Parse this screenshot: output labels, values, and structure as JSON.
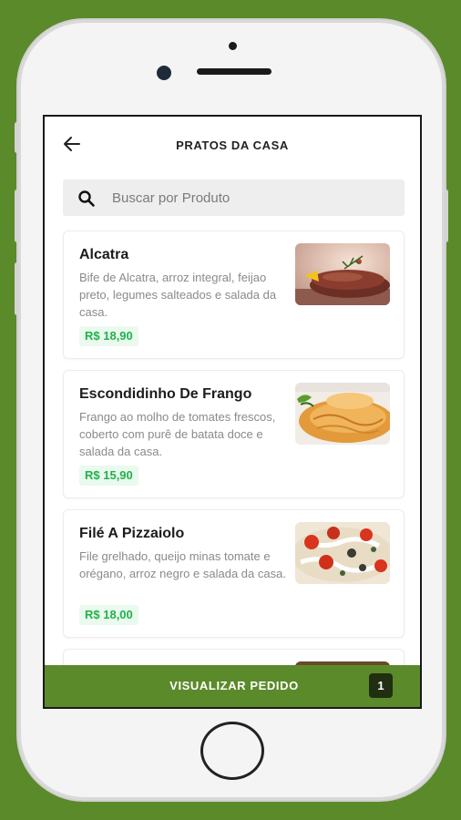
{
  "header": {
    "title": "PRATOS DA CASA"
  },
  "search": {
    "placeholder": "Buscar por Produto"
  },
  "products": [
    {
      "name": "Alcatra",
      "description": "Bife de Alcatra, arroz integral, feijao preto, legumes salteados e salada da casa.",
      "price": "R$ 18,90"
    },
    {
      "name": "Escondidinho De Frango",
      "description": "Frango ao molho de tomates frescos, coberto com purê de batata doce e salada da casa.",
      "price": "R$ 15,90"
    },
    {
      "name": "Filé A Pizzaiolo",
      "description": "File grelhado, queijo minas tomate e orégano, arroz negro e salada da casa.",
      "price": "R$ 18,00"
    }
  ],
  "footer": {
    "cta_label": "VISUALIZAR PEDIDO",
    "order_count": "1"
  },
  "colors": {
    "accent": "#5b8a2a",
    "price": "#22b14c",
    "price_bg": "#eafaee"
  },
  "icons": [
    "back-arrow-icon",
    "search-icon"
  ]
}
